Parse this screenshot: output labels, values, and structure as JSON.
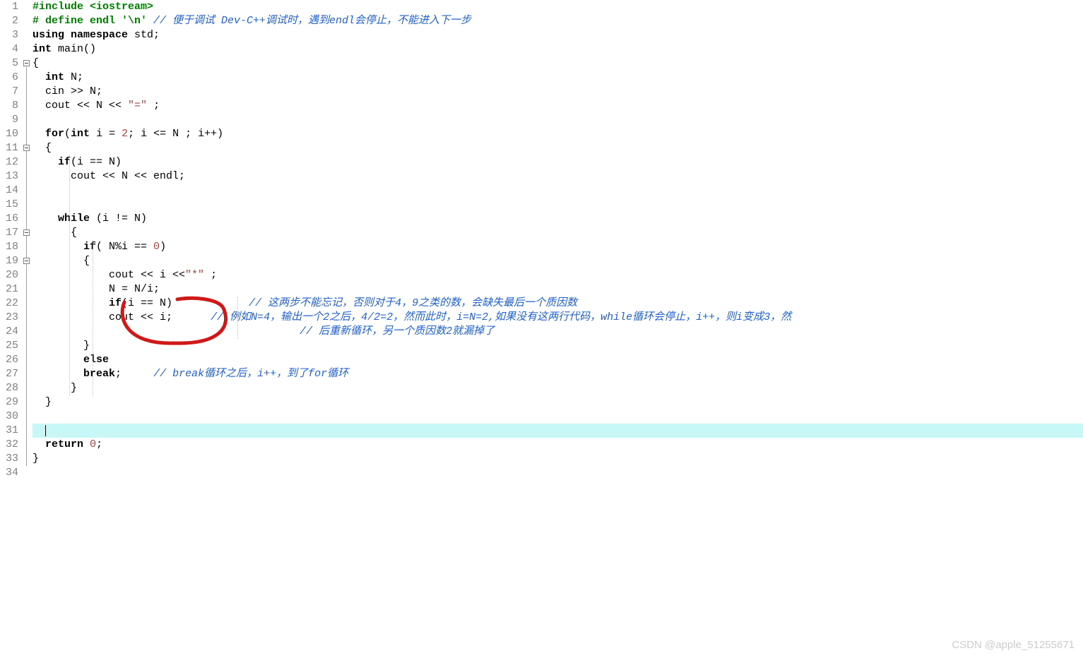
{
  "watermark": "CSDN @apple_51255671",
  "lines": {
    "l1_pp": "#include <iostream>",
    "l2_pp": "# define endl '\\n' ",
    "l2_com": "// 便于调试 Dev-C++调试时，遇到endl会停止，不能进入下一步",
    "l3_kw1": "using",
    "l3_kw2": "namespace",
    "l3_txt": " std;",
    "l4_kw": "int",
    "l4_txt": " main()",
    "l5_txt": "{",
    "l6_kw": "int",
    "l6_txt": " N;",
    "l7_txt": "cin >> N;",
    "l8_a": "cout << N << ",
    "l8_str": "\"=\"",
    "l8_b": " ;",
    "l10_kw1": "for",
    "l10_a": "(",
    "l10_kw2": "int",
    "l10_b": " i = ",
    "l10_n1": "2",
    "l10_c": "; i <= N ; i++)",
    "l11_txt": "{",
    "l12_kw": "if",
    "l12_txt": "(i == N)",
    "l13_txt": "  cout << N << endl;",
    "l16_kw": "while",
    "l16_txt": " (i != N)",
    "l17_txt": "  {",
    "l18_kw": "if",
    "l18_a": "( N%i == ",
    "l18_n": "0",
    "l18_b": ")",
    "l19_txt": "{",
    "l20_a": "    cout << i <<",
    "l20_str": "\"*\"",
    "l20_b": " ;",
    "l21_txt": "    N = N/i;",
    "l22_kw": "if",
    "l22_txt": "(i == N)",
    "l22_com": "// 这两步不能忘记，否则对于4，9之类的数，会缺失最后一个质因数",
    "l23_txt": "    cout << i;",
    "l23_com": "// 例如N=4，输出一个2之后，4/2=2，然而此时，i=N=2,如果没有这两行代码，while循环会停止，i++，则i变成3，然",
    "l24_com": "// 后重新循环，另一个质因数2就漏掉了",
    "l25_txt": "}",
    "l26_kw": "else",
    "l27_kw": "break",
    "l27_txt": ";",
    "l27_com": "// break循环之后，i++，到了for循环",
    "l28_txt": "  }",
    "l29_txt": "}",
    "l32_kw": "return",
    "l32_a": " ",
    "l32_n": "0",
    "l32_b": ";",
    "l33_txt": "}"
  },
  "line_numbers": [
    "1",
    "2",
    "3",
    "4",
    "5",
    "6",
    "7",
    "8",
    "9",
    "10",
    "11",
    "12",
    "13",
    "14",
    "15",
    "16",
    "17",
    "18",
    "19",
    "20",
    "21",
    "22",
    "23",
    "24",
    "25",
    "26",
    "27",
    "28",
    "29",
    "30",
    "31",
    "32",
    "33",
    "34"
  ]
}
